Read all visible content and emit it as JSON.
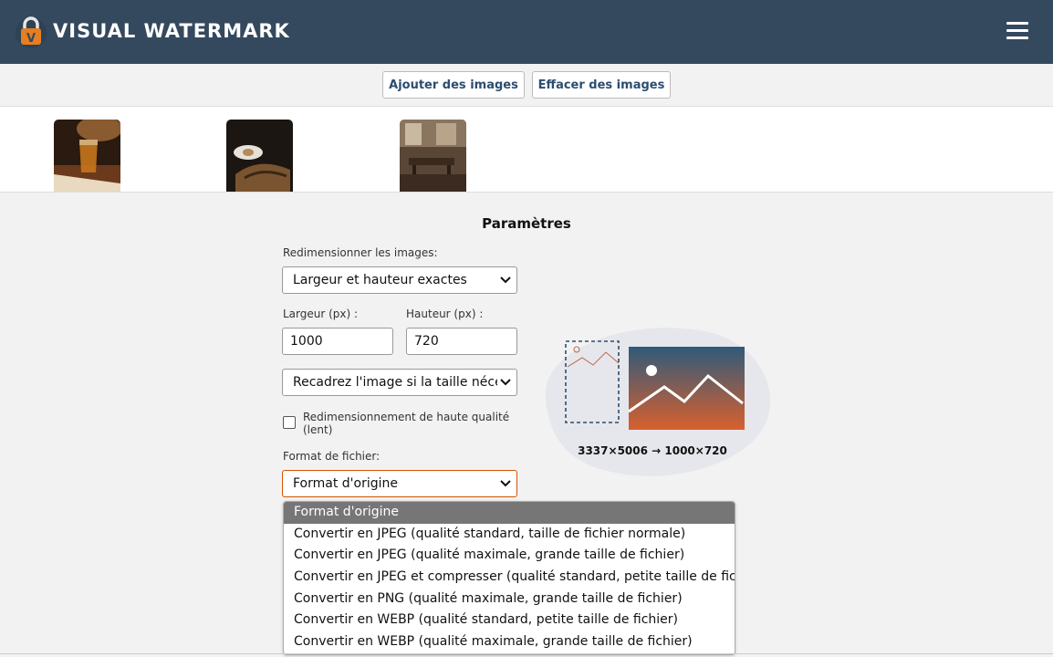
{
  "header": {
    "brand": "VISUAL WATERMARK",
    "logo_icon": "padlock-v-icon",
    "menu_icon": "hamburger-menu-icon",
    "colors": {
      "header_bg": "#34495e",
      "logo_orange": "#e67e22"
    }
  },
  "toolbar": {
    "add_images": "Ajouter des images",
    "clear_images": "Effacer des images"
  },
  "gallery": {
    "thumbnails": [
      "photo-drink-icon",
      "photo-coffee-cake-icon",
      "photo-cafe-interior-icon"
    ]
  },
  "settings": {
    "title": "Paramètres",
    "resize_label": "Redimensionner les images:",
    "resize_value": "Largeur et hauteur exactes",
    "width_label": "Largeur (px) :",
    "width_value": "1000",
    "height_label": "Hauteur (px) :",
    "height_value": "720",
    "crop_value": "Recadrez l'image si la taille nécessaire",
    "hq_label": "Redimensionnement de haute qualité (lent)",
    "hq_checked": false,
    "format_label": "Format de fichier:",
    "format_value": "Format d'origine",
    "format_options": [
      "Format d'origine",
      "Convertir en JPEG (qualité standard, taille de fichier normale)",
      "Convertir en JPEG (qualité maximale, grande taille de fichier)",
      "Convertir en JPEG et compresser (qualité standard, petite taille de fichier)",
      "Convertir en PNG (qualité maximale, grande taille de fichier)",
      "Convertir en WEBP (qualité standard, petite taille de fichier)",
      "Convertir en WEBP (qualité maximale, grande taille de fichier)"
    ]
  },
  "preview": {
    "dimensions": "3337×5006 → 1000×720",
    "icon": "resize-preview-illustration"
  }
}
